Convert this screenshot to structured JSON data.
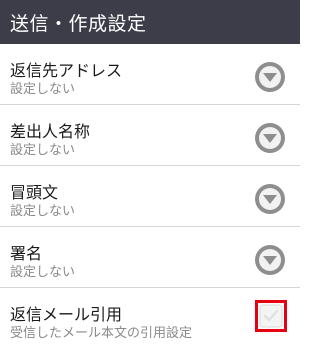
{
  "header": {
    "title": "送信・作成設定"
  },
  "settings": {
    "items": [
      {
        "label": "返信先アドレス",
        "sub": "設定しない",
        "action_icon": "chevron-down-circle-icon"
      },
      {
        "label": "差出人名称",
        "sub": "設定しない",
        "action_icon": "chevron-down-circle-icon"
      },
      {
        "label": "冒頭文",
        "sub": "設定しない",
        "action_icon": "chevron-down-circle-icon"
      },
      {
        "label": "署名",
        "sub": "設定しない",
        "action_icon": "chevron-down-circle-icon"
      },
      {
        "label": "返信メール引用",
        "sub": "受信したメール本文の引用設定",
        "action_icon": "checkbox-icon",
        "checked": false
      }
    ]
  },
  "colors": {
    "title_bar_bg": "#3d3d49",
    "title_text": "#ffffff",
    "icon_circle": "#8e8e8e",
    "checkbox_highlight": "#e60012"
  }
}
